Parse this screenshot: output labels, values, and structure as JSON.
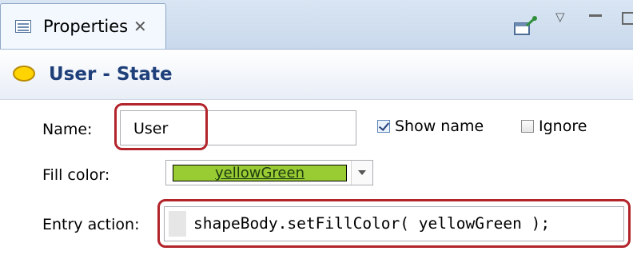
{
  "view": {
    "tab_label": "Properties",
    "close_glyph": "✕",
    "toolbar_icons": [
      "pin-icon",
      "view-menu-icon",
      "minimize-icon",
      "maximize-icon"
    ]
  },
  "header": {
    "title": "User - State",
    "state_icon_color": "#ffd400"
  },
  "form": {
    "name_label": "Name:",
    "name_value": "User",
    "show_name_label": "Show name",
    "show_name_checked": true,
    "ignore_label": "Ignore",
    "ignore_checked": false,
    "fill_color_label": "Fill color:",
    "fill_color_value": "yellowGreen",
    "fill_color_hex": "#99cc33",
    "entry_action_label": "Entry action:",
    "entry_action_code": "shapeBody.setFillColor( yellowGreen );"
  },
  "highlight_color": "#b2232a"
}
